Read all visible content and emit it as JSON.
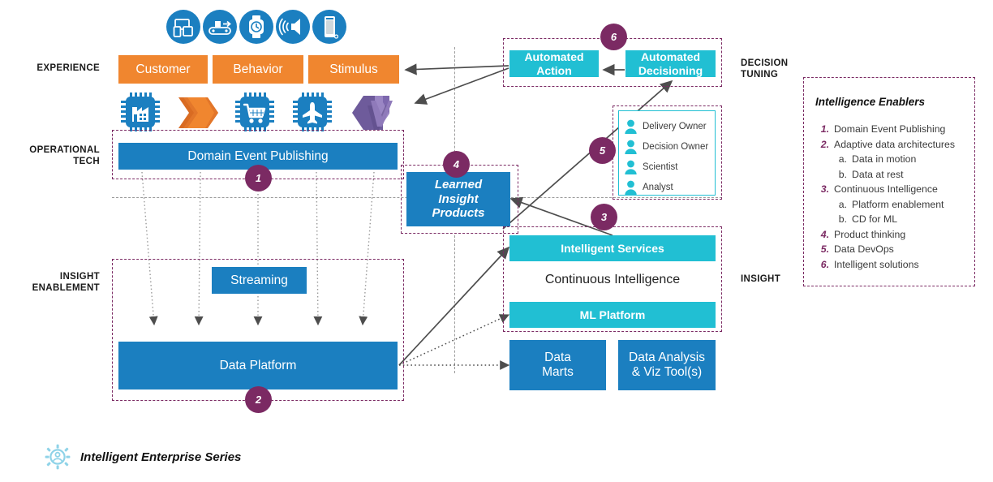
{
  "rows": {
    "experience": "EXPERIENCE",
    "operational_tech": "OPERATIONAL\nTECH",
    "operational_tech_l1": "OPERATIONAL",
    "operational_tech_l2": "TECH",
    "insight_enablement_l1": "INSIGHT",
    "insight_enablement_l2": "ENABLEMENT",
    "decision_tuning_l1": "DECISION",
    "decision_tuning_l2": "TUNING",
    "insight": "INSIGHT"
  },
  "device_icons": [
    {
      "name": "devices-icon",
      "label": "devices"
    },
    {
      "name": "conveyor-belt-icon",
      "label": "conveyor"
    },
    {
      "name": "smartwatch-icon",
      "label": "smartwatch"
    },
    {
      "name": "sensor-speaker-icon",
      "label": "sensor"
    },
    {
      "name": "mobile-device-icon",
      "label": "mobile device"
    }
  ],
  "industry_icons": [
    {
      "name": "chip-factory-icon",
      "label": "manufacturing"
    },
    {
      "name": "hexagon-stack-icon",
      "label": "stack"
    },
    {
      "name": "chip-cart-icon",
      "label": "retail"
    },
    {
      "name": "chip-plane-icon",
      "label": "travel"
    },
    {
      "name": "hexagon-cube-icon",
      "label": "cube"
    }
  ],
  "experience": {
    "customer": "Customer",
    "behavior": "Behavior",
    "stimulus": "Stimulus"
  },
  "operational": {
    "domain_event_publishing": "Domain Event Publishing",
    "badge": "1"
  },
  "insight_enablement": {
    "streaming": "Streaming",
    "data_platform": "Data Platform",
    "badge": "2"
  },
  "decision_tuning": {
    "automated_action": "Automated\nAction",
    "automated_action_l1": "Automated",
    "automated_action_l2": "Action",
    "automated_decisioning_l1": "Automated",
    "automated_decisioning_l2": "Decisioning",
    "badge": "6"
  },
  "roles": {
    "badge": "5",
    "items": [
      "Delivery Owner",
      "Decision Owner",
      "Scientist",
      "Analyst"
    ]
  },
  "learned_insight": {
    "line1": "Learned",
    "line2": "Insight",
    "line3": "Products",
    "badge": "4"
  },
  "continuous_intelligence": {
    "intelligent_services": "Intelligent Services",
    "title": "Continuous Intelligence",
    "ml_platform": "ML Platform",
    "badge": "3"
  },
  "consumption": {
    "data_marts_l1": "Data",
    "data_marts_l2": "Marts",
    "data_viz_l1": "Data Analysis",
    "data_viz_l2": "& Viz Tool(s)"
  },
  "legend": {
    "title": "Intelligence Enablers",
    "items": [
      {
        "num": "1.",
        "text": "Domain Event Publishing",
        "subs": []
      },
      {
        "num": "2.",
        "text": "Adaptive data architectures",
        "subs": [
          {
            "alpha": "a.",
            "text": "Data in motion"
          },
          {
            "alpha": "b.",
            "text": "Data at rest"
          }
        ]
      },
      {
        "num": "3.",
        "text": "Continuous Intelligence",
        "subs": [
          {
            "alpha": "a.",
            "text": "Platform enablement"
          },
          {
            "alpha": "b.",
            "text": "CD for ML"
          }
        ]
      },
      {
        "num": "4.",
        "text": "Product thinking",
        "subs": []
      },
      {
        "num": "5.",
        "text": "Data DevOps",
        "subs": []
      },
      {
        "num": "6.",
        "text": "Intelligent solutions",
        "subs": []
      }
    ]
  },
  "footer": {
    "title": "Intelligent Enterprise Series",
    "icon": "gear-person-icon"
  },
  "colors": {
    "orange": "#F0862F",
    "blue": "#1B7FC0",
    "teal": "#21BFD3",
    "purple": "#7B2A63",
    "gray_line": "#4d4d4d",
    "purple_light_icon": "#8268AE"
  }
}
